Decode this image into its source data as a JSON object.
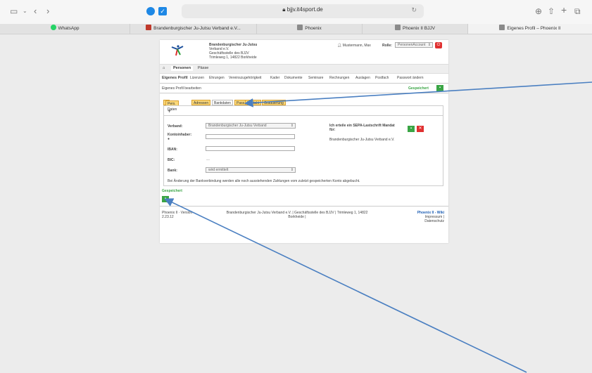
{
  "browser": {
    "url": "bjjv.it4sport.de",
    "tabs": [
      {
        "label": "WhatsApp",
        "color": "#25d366"
      },
      {
        "label": "Brandenburgischer Ju-Jutsu Verband e.V...",
        "color": "#c0392b"
      },
      {
        "label": "Phoenix",
        "color": "#8a8a8a"
      },
      {
        "label": "Phoenix II BJJV",
        "color": "#8a8a8a"
      },
      {
        "label": "Eigenes Profil – Phoenix II",
        "color": "#8a8a8a"
      }
    ]
  },
  "header": {
    "org_line1": "Brandenburgischer Ju-Jutsu",
    "org_line2": "Verband e.V.",
    "org_line3": "Geschäftsstelle des BJJV",
    "org_line4": "Trimleweg 1, 14822 Borkheide",
    "user": "Mustermann, Max",
    "role_label": "Rolle:",
    "role_value": "PersonenAccount"
  },
  "nav_main": [
    "Personen",
    "Pässe"
  ],
  "nav_sub": [
    "Eigenes Profil",
    "Lizenzen",
    "Ehrungen",
    "Vereinszugehörigkeit",
    "Kader",
    "Dokumente",
    "Seminare",
    "Rechnungen",
    "Auslagen",
    "Postfach",
    "Passwort ändern"
  ],
  "section_title": "Eigenes Profil bearbeiten",
  "saved_top": "Gespeichert",
  "subtabs": [
    {
      "label": "Pers. Daten",
      "active": false
    },
    {
      "label": "Adressen",
      "active": false
    },
    {
      "label": "Bankdaten",
      "active": true
    },
    {
      "label": "Pass",
      "active": false
    },
    {
      "label": "Kontakt",
      "active": false
    },
    {
      "label": "Graduierung",
      "active": false
    }
  ],
  "form": {
    "verband_label": "Verband:",
    "verband_value": "Brandenburgischer Ju-Jutsu Verband",
    "kontoinhaber_label": "Kontoinhaber:",
    "iban_label": "IBAN:",
    "bic_label": "BIC:",
    "bic_value": "---",
    "bank_label": "Bank:",
    "bank_value": "wird ermittelt",
    "sepa_label": "Ich erteile ein SEPA-Lastschrift Mandat für:",
    "sepa_org": "Brandenburgischer Ju-Jutsu Verband e.V.",
    "note": "Bei Änderung der Bankverbindung werden alle noch ausstehenden Zahlungen vom zuletzt gespeicherten Konto abgebucht."
  },
  "saved_bottom": "Gespeichert",
  "footer": {
    "version": "Phoenix II · Version 2.23.12",
    "center_line1": "Brandenburgischer Ju-Jutsu Verband e.V. | Geschäftsstelle des BJJV | Trimleweg 1, 14822",
    "center_line2": "Borkheide |",
    "wiki": "Phoenix II - Wiki",
    "impressum": "Impressum |",
    "datenschutz": "Datenschutz"
  },
  "colors": {
    "save_green": "#3aa545",
    "cancel_red": "#e03030",
    "tab_yellow": "#fbd97a",
    "arrow_blue": "#4a7fc1",
    "wiki_blue": "#1e5fb4"
  }
}
